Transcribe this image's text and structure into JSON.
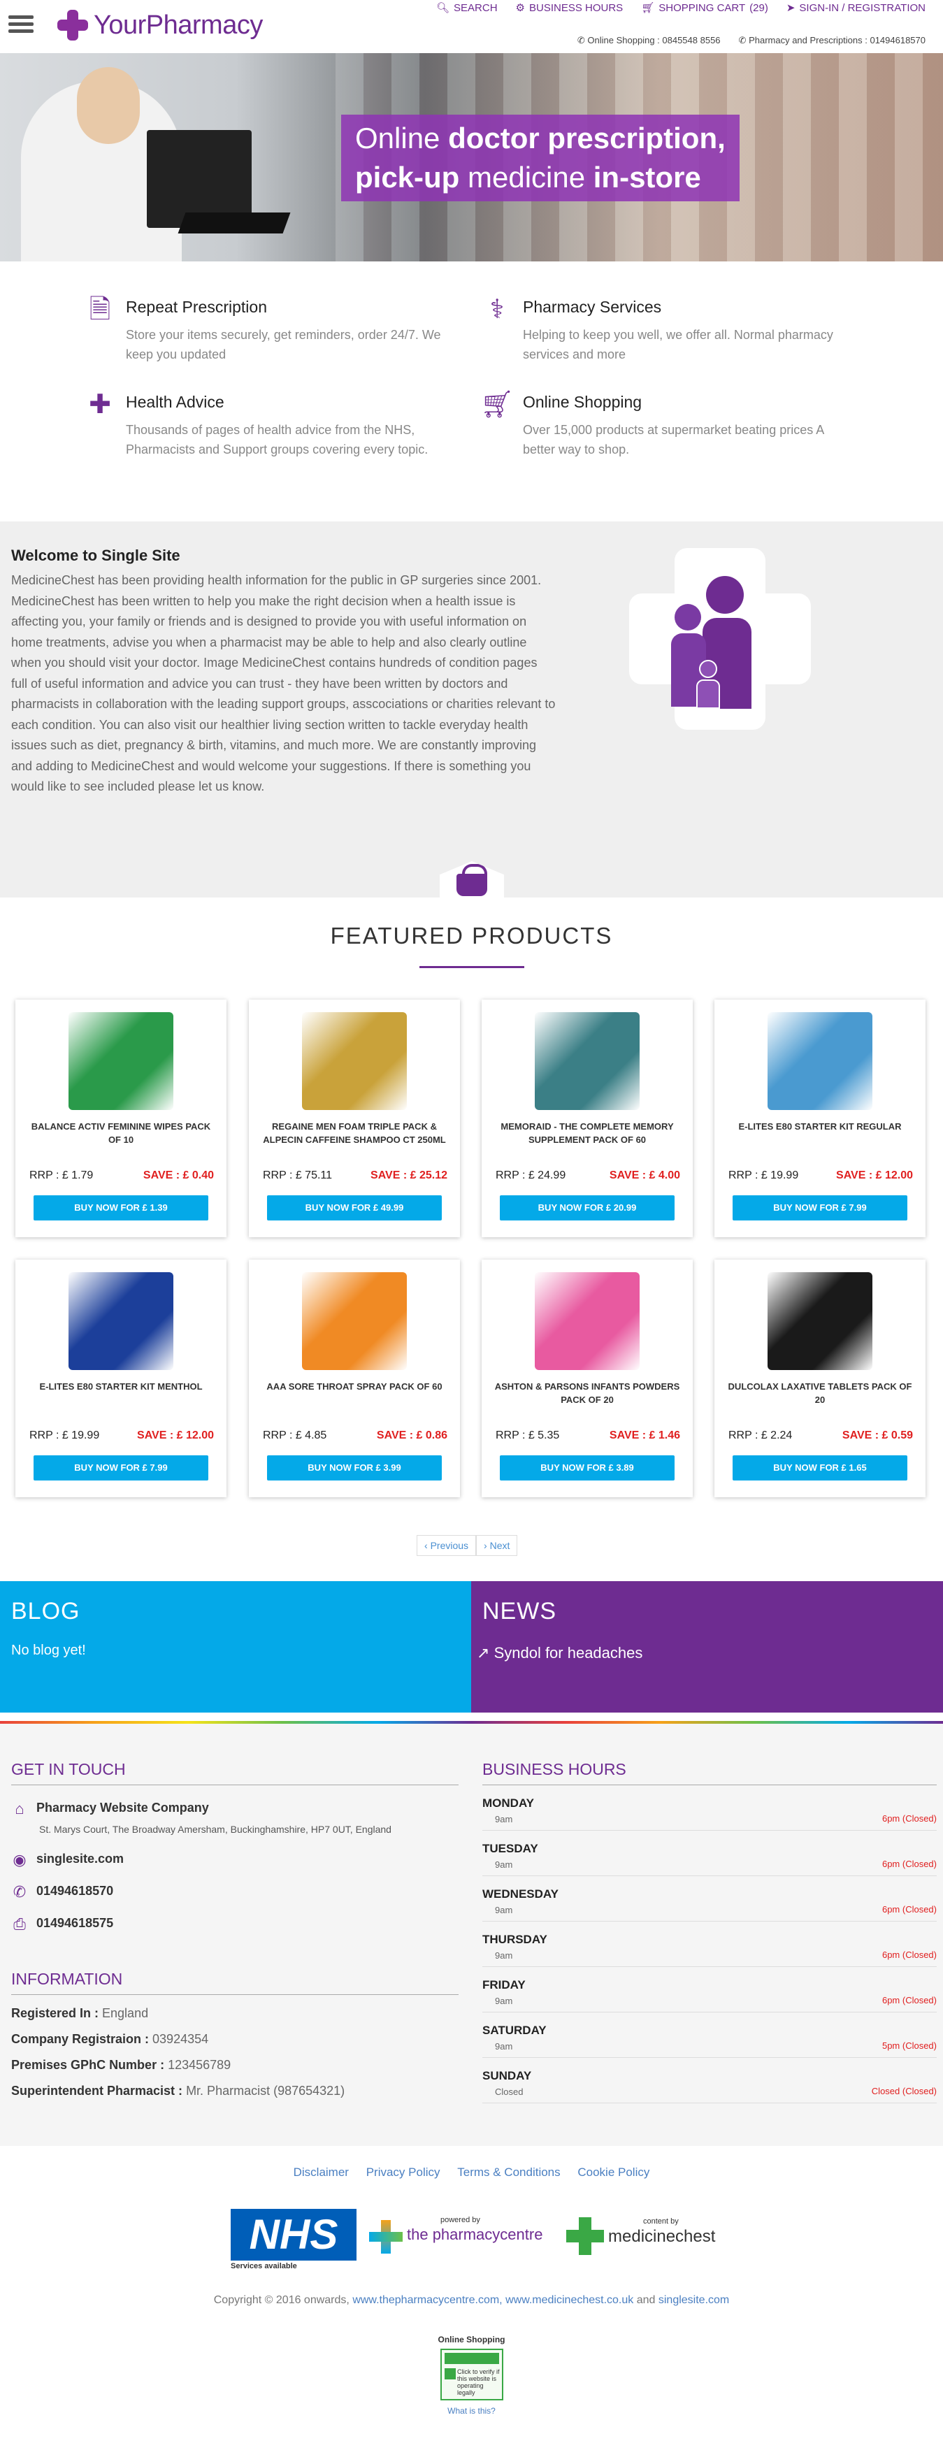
{
  "header": {
    "logo_text_prefix": "Your",
    "logo_text_suffix": "Pharmacy",
    "nav": {
      "search": "SEARCH",
      "business_hours": "BUSINESS HOURS",
      "shopping_cart": "SHOPPING CART",
      "cart_count": "(29)",
      "sign_in": "SIGN-IN / REGISTRATION"
    },
    "contact": {
      "online_shopping": "Online Shopping : 0845548 8556",
      "pharmacy_prescriptions": "Pharmacy and Prescriptions : 01494618570"
    }
  },
  "hero": {
    "line1_light": "Online ",
    "line1_bold": "doctor prescription,",
    "line2_bold_a": "pick-up",
    "line2_light": " medicine ",
    "line2_bold_b": "in-store"
  },
  "services": [
    {
      "title": "Repeat Prescription",
      "text": "Store your items securely, get reminders, order 24/7. We keep you updated",
      "icon": "document-icon"
    },
    {
      "title": "Pharmacy Services",
      "text": "Helping to keep you well, we offer all. Normal pharmacy services and more",
      "icon": "doctor-icon"
    },
    {
      "title": "Health Advice",
      "text": "Thousands of pages of health advice from the NHS, Pharmacists and Support groups covering every topic.",
      "icon": "medkit-icon"
    },
    {
      "title": "Online Shopping",
      "text": "Over 15,000 products at supermarket beating prices A better way to shop.",
      "icon": "cart-icon"
    }
  ],
  "welcome": {
    "title": "Welcome to Single Site",
    "body": "MedicineChest has been providing health information for the public in GP surgeries since 2001. MedicineChest has been written to help you make the right decision when a health issue is affecting you, your family or friends and is designed to provide you with useful information on home treatments, advise you when a pharmacist may be able to help and also clearly outline when you should visit your doctor. Image MedicineChest contains hundreds of condition pages full of useful information and advice you can trust - they have been written by doctors and pharmacists in collaboration with the leading support groups, asscociations or charities relevant to each condition. You can also visit our healthier living section written to tackle everyday health issues such as diet, pregnancy & birth, vitamins, and much more. We are constantly improving and adding to MedicineChest and would welcome your suggestions. If there is something you would like to see included please let us know."
  },
  "featured": {
    "title": "FEATURED PRODUCTS",
    "products": [
      {
        "name": "BALANCE ACTIV FEMININE WIPES PACK OF 10",
        "rrp": "RRP : £ 1.79",
        "save": "SAVE : £ 0.40",
        "buy": "BUY NOW FOR £ 1.39",
        "img_color": "#2a9a4a"
      },
      {
        "name": "REGAINE MEN FOAM TRIPLE PACK & ALPECIN CAFFEINE SHAMPOO CT 250ML",
        "rrp": "RRP : £ 75.11",
        "save": "SAVE : £ 25.12",
        "buy": "BUY NOW FOR £ 49.99",
        "img_color": "#c9a23a"
      },
      {
        "name": "MEMORAID - THE COMPLETE MEMORY SUPPLEMENT PACK OF 60",
        "rrp": "RRP : £ 24.99",
        "save": "SAVE : £ 4.00",
        "buy": "BUY NOW FOR £ 20.99",
        "img_color": "#3b7f86"
      },
      {
        "name": "E-LITES E80 STARTER KIT REGULAR",
        "rrp": "RRP : £ 19.99",
        "save": "SAVE : £ 12.00",
        "buy": "BUY NOW FOR £ 7.99",
        "img_color": "#4a9ad0"
      },
      {
        "name": "E-LITES E80 STARTER KIT MENTHOL",
        "rrp": "RRP : £ 19.99",
        "save": "SAVE : £ 12.00",
        "buy": "BUY NOW FOR £ 7.99",
        "img_color": "#1c3f9a"
      },
      {
        "name": "AAA SORE THROAT SPRAY PACK OF 60",
        "rrp": "RRP : £ 4.85",
        "save": "SAVE : £ 0.86",
        "buy": "BUY NOW FOR £ 3.99",
        "img_color": "#f08a24"
      },
      {
        "name": "ASHTON & PARSONS INFANTS POWDERS PACK OF 20",
        "rrp": "RRP : £ 5.35",
        "save": "SAVE : £ 1.46",
        "buy": "BUY NOW FOR £ 3.89",
        "img_color": "#e85aa0"
      },
      {
        "name": "DULCOLAX LAXATIVE TABLETS PACK OF 20",
        "rrp": "RRP : £ 2.24",
        "save": "SAVE : £ 0.59",
        "buy": "BUY NOW FOR £ 1.65",
        "img_color": "#1a1a1a"
      }
    ],
    "prev": "Previous",
    "next": "Next"
  },
  "blog": {
    "title": "BLOG",
    "text": "No blog yet!"
  },
  "news": {
    "title": "NEWS",
    "item": "Syndol for headaches"
  },
  "get_in_touch": {
    "title": "GET IN TOUCH",
    "company": "Pharmacy Website Company",
    "address": "St. Marys Court, The Broadway Amersham, Buckinghamshire, HP7 0UT, England",
    "website": "singlesite.com",
    "phone": "01494618570",
    "fax": "01494618575"
  },
  "information": {
    "title": "INFORMATION",
    "rows": [
      {
        "label": "Registered In : ",
        "value": "England"
      },
      {
        "label": "Company Registraion : ",
        "value": "03924354"
      },
      {
        "label": "Premises GPhC Number : ",
        "value": "123456789"
      },
      {
        "label": "Superintendent Pharmacist : ",
        "value": "Mr. Pharmacist (987654321)"
      }
    ]
  },
  "business_hours": {
    "title": "BUSINESS HOURS",
    "days": [
      {
        "day": "MONDAY",
        "open": "9am",
        "close": "6pm (Closed)"
      },
      {
        "day": "TUESDAY",
        "open": "9am",
        "close": "6pm (Closed)"
      },
      {
        "day": "WEDNESDAY",
        "open": "9am",
        "close": "6pm (Closed)"
      },
      {
        "day": "THURSDAY",
        "open": "9am",
        "close": "6pm (Closed)"
      },
      {
        "day": "FRIDAY",
        "open": "9am",
        "close": "6pm (Closed)"
      },
      {
        "day": "SATURDAY",
        "open": "9am",
        "close": "5pm (Closed)"
      },
      {
        "day": "SUNDAY",
        "open": "Closed",
        "close": "Closed (Closed)"
      }
    ]
  },
  "footer": {
    "links": [
      "Disclaimer",
      "Privacy Policy",
      "Terms & Conditions",
      "Cookie Policy"
    ],
    "nhs": "NHS",
    "nhs_sub": "Services available",
    "powered_by": "powered by",
    "pharmacy_centre": "the pharmacycentre",
    "content_by": "content by",
    "medicinechest": "medicinechest",
    "copyright_prefix": "Copyright © 2016 onwards,",
    "link1": "www.thepharmacycentre.com,",
    "link2": "www.medicinechest.co.uk",
    "and": "and",
    "link3": "singlesite.com",
    "badge_title": "Online Shopping",
    "badge_text": "Click to verify if this website is operating legally",
    "what_is_this": "What is this?"
  },
  "colors": {
    "brand_purple": "#6e2c91",
    "accent_blue": "#04a9e8",
    "save_red": "#e02020"
  }
}
